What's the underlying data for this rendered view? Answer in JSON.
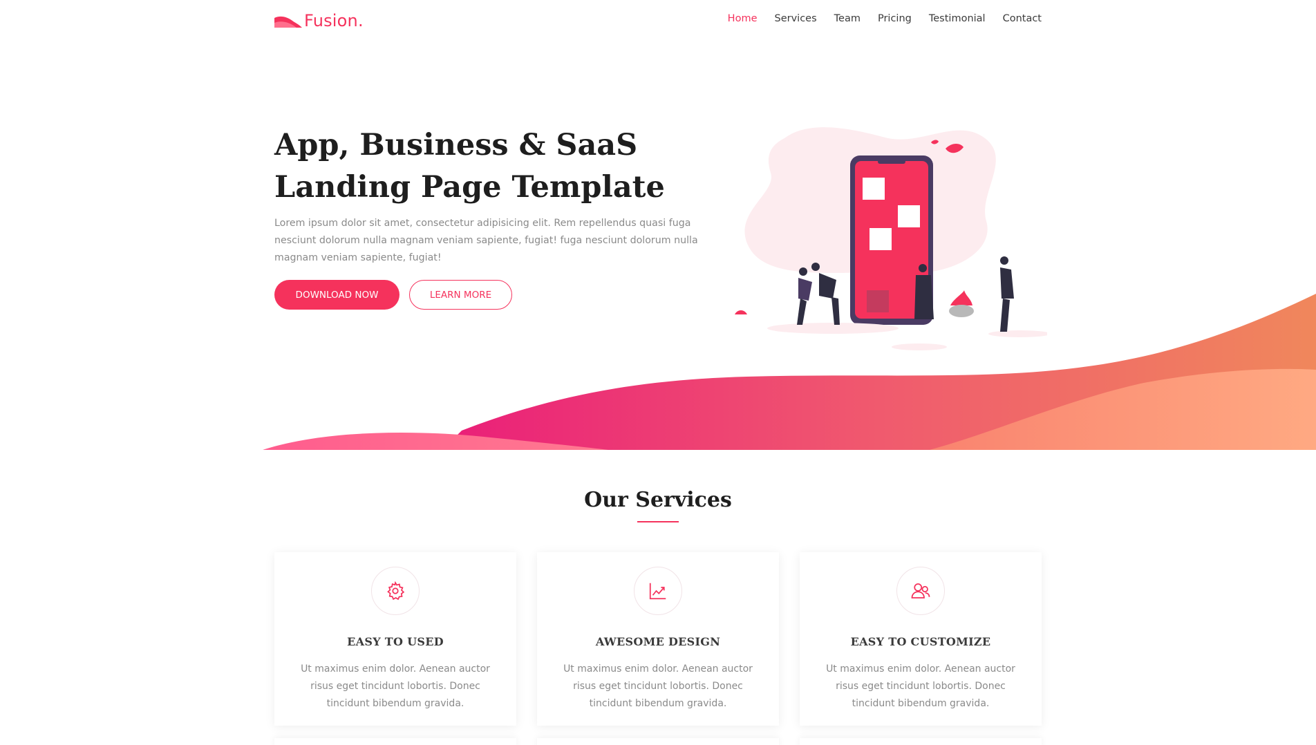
{
  "brand": {
    "name": "Fusion.",
    "logo_icon": "wave-logo-icon",
    "accent_color": "#f5325c"
  },
  "nav": {
    "items": [
      {
        "label": "Home",
        "active": true
      },
      {
        "label": "Services",
        "active": false
      },
      {
        "label": "Team",
        "active": false
      },
      {
        "label": "Pricing",
        "active": false
      },
      {
        "label": "Testimonial",
        "active": false
      },
      {
        "label": "Contact",
        "active": false
      }
    ]
  },
  "hero": {
    "title_line1": "App, Business & SaaS",
    "title_line2": "Landing Page Template",
    "description": "Lorem ipsum dolor sit amet, consectetur adipisicing elit. Rem repellendus quasi fuga nesciunt dolorum nulla magnam veniam sapiente, fugiat! fuga nesciunt dolorum nulla magnam veniam sapiente, fugiat!",
    "primary_button": "DOWNLOAD NOW",
    "secondary_button": "LEARN MORE"
  },
  "services": {
    "title": "Our Services",
    "cards": [
      {
        "icon": "gear-icon",
        "title": "EASY TO USED",
        "text": "Ut maximus enim dolor. Aenean auctor risus eget tincidunt lobortis. Donec tincidunt bibendum gravida."
      },
      {
        "icon": "chart-icon",
        "title": "AWESOME DESIGN",
        "text": "Ut maximus enim dolor. Aenean auctor risus eget tincidunt lobortis. Donec tincidunt bibendum gravida."
      },
      {
        "icon": "users-icon",
        "title": "EASY TO CUSTOMIZE",
        "text": "Ut maximus enim dolor. Aenean auctor risus eget tincidunt lobortis. Donec tincidunt bibendum gravida."
      }
    ]
  }
}
